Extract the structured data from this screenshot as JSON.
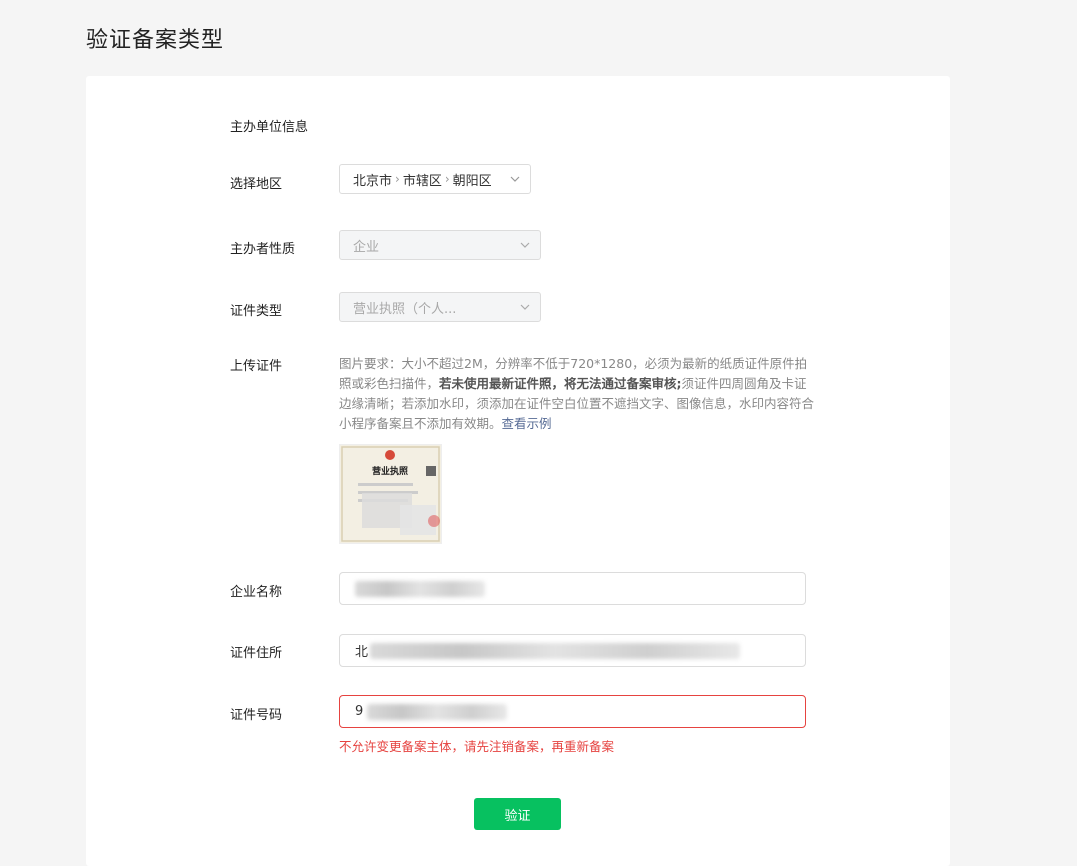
{
  "page": {
    "title": "验证备案类型"
  },
  "form": {
    "section_title": "主办单位信息",
    "region": {
      "label": "选择地区",
      "province": "北京市",
      "city": "市辖区",
      "district": "朝阳区"
    },
    "organizer_type": {
      "label": "主办者性质",
      "value": "企业"
    },
    "cert_type": {
      "label": "证件类型",
      "value": "营业执照（个人..."
    },
    "upload": {
      "label": "上传证件",
      "hint_part1": "图片要求：大小不超过2M，分辨率不低于720*1280，必须为最新的纸质证件原件拍照或彩色扫描件，",
      "hint_bold": "若未使用最新证件照，将无法通过备案审核;",
      "hint_part2": "须证件四周圆角及卡证边缘清晰；若添加水印，须添加在证件空白位置不遮挡文字、图像信息，水印内容符合小程序备案且不添加有效期。",
      "example_link": "查看示例",
      "thumbnail_title": "营业执照"
    },
    "company_name": {
      "label": "企业名称",
      "value": ""
    },
    "cert_address": {
      "label": "证件住所",
      "value_prefix": "北"
    },
    "cert_number": {
      "label": "证件号码",
      "value_prefix": "9"
    },
    "error_message": "不允许变更备案主体，请先注销备案，再重新备案",
    "submit_label": "验证"
  },
  "colors": {
    "accent_green": "#07c160",
    "error_red": "#e64340",
    "link_blue": "#576b95"
  }
}
